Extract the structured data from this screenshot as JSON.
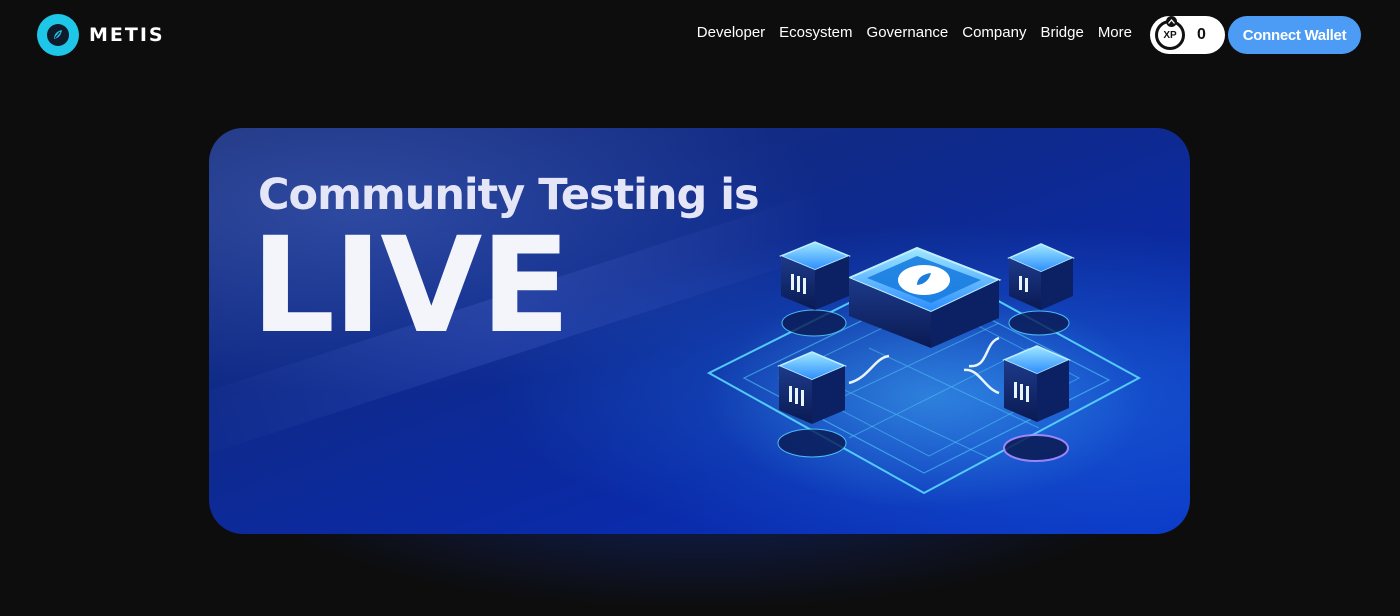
{
  "header": {
    "brand_name": "METIS",
    "nav": [
      {
        "label": "Developer"
      },
      {
        "label": "Ecosystem"
      },
      {
        "label": "Governance"
      },
      {
        "label": "Company"
      },
      {
        "label": "Bridge"
      },
      {
        "label": "More"
      }
    ],
    "xp_badge_label": "XP",
    "xp_count": "0",
    "connect_label": "Connect Wallet"
  },
  "hero": {
    "title": "Community Testing is",
    "headline": "LIVE",
    "illustration": "blockchain-nodes-illustration"
  },
  "colors": {
    "page_background": "#0d0d0e",
    "brand_accent": "#1ec6e8",
    "button_blue": "#4c9cf6",
    "hero_blue": "#0b39c9",
    "node_cyan": "#5ad8ff"
  },
  "icons": {
    "logo": "metis-leaf-icon",
    "xp": "xp-badge-icon"
  }
}
